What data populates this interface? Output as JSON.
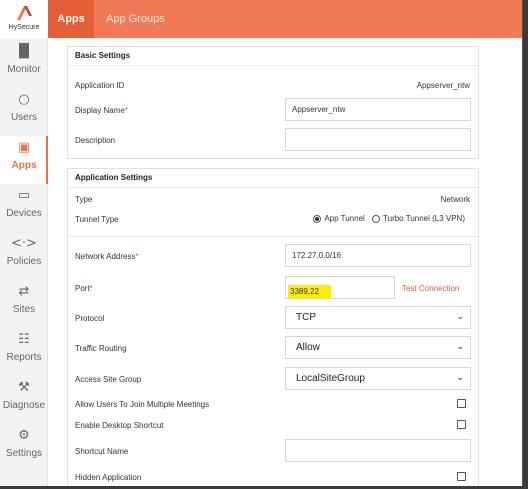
{
  "brand": {
    "name": "HySecure",
    "accent": "#f07a57"
  },
  "sidebar": {
    "items": [
      {
        "label": "Monitor",
        "icon": "bar-chart-icon"
      },
      {
        "label": "Users",
        "icon": "user-icon"
      },
      {
        "label": "Apps",
        "icon": "apps-grid-icon",
        "active": true
      },
      {
        "label": "Devices",
        "icon": "laptop-icon"
      },
      {
        "label": "Policies",
        "icon": "code-arrows-icon"
      },
      {
        "label": "Sites",
        "icon": "swap-arrows-icon"
      },
      {
        "label": "Reports",
        "icon": "document-icon"
      },
      {
        "label": "Diagnose",
        "icon": "wrench-icon"
      },
      {
        "label": "Settings",
        "icon": "gear-icon"
      }
    ]
  },
  "tabs": {
    "apps": "Apps",
    "app_groups": "App Groups"
  },
  "basic": {
    "title": "Basic Settings",
    "app_id_label": "Application ID",
    "app_id_value": "Appserver_ntw",
    "display_name_label": "Display Name",
    "display_name_value": "Appserver_ntw",
    "description_label": "Description",
    "description_value": ""
  },
  "app_settings": {
    "title": "Application Settings",
    "type_label": "Type",
    "type_value": "Network",
    "tunnel_label": "Tunnel Type",
    "tunnel_options": [
      "App Tunnel",
      "Turbo Tunnel (L3 VPN)"
    ],
    "tunnel_selected": "App Tunnel",
    "network_label": "Network Address",
    "network_value": "172.27.0.0/16",
    "port_label": "Port",
    "port_value": "3389,22",
    "test_connection": "Test Connection",
    "protocol_label": "Protocol",
    "protocol_value": "TCP",
    "routing_label": "Traffic Routing",
    "routing_value": "Allow",
    "site_group_label": "Access Site Group",
    "site_group_value": "LocalSiteGroup",
    "multi_meeting_label": "Allow Users To Join Multiple Meetings",
    "desktop_shortcut_label": "Enable Desktop Shortcut",
    "shortcut_name_label": "Shortcut Name",
    "shortcut_name_value": "",
    "hidden_app_label": "Hidden Application"
  }
}
